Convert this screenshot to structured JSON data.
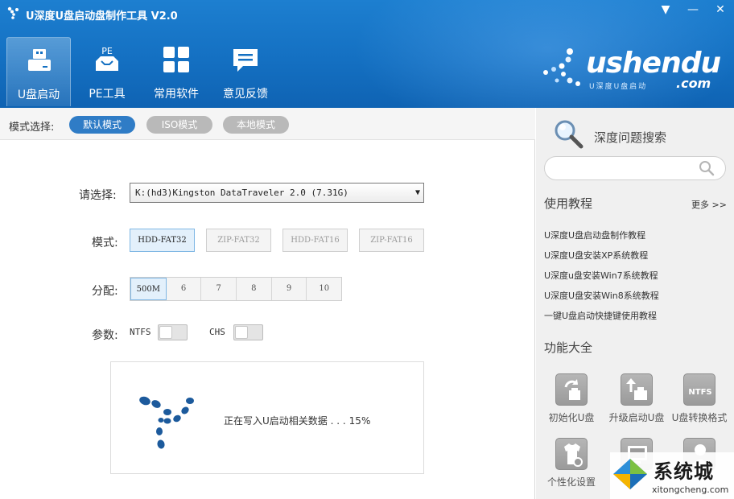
{
  "window": {
    "title": "U深度U盘启动盘制作工具 V2.0",
    "menu_glyph": "▼",
    "min_glyph": "—",
    "close_glyph": "✕"
  },
  "nav": {
    "items": [
      {
        "label": "U盘启动",
        "icon": "usb-drive-icon",
        "active": true
      },
      {
        "label": "PE工具",
        "icon": "pe-tools-icon",
        "active": false
      },
      {
        "label": "常用软件",
        "icon": "apps-grid-icon",
        "active": false
      },
      {
        "label": "意见反馈",
        "icon": "feedback-bubble-icon",
        "active": false
      }
    ],
    "pe_badge": "PE"
  },
  "brand": {
    "name": "ushendu",
    "domain": ".com",
    "subtitle": "U深度U盘启动"
  },
  "mode_bar": {
    "label": "模式选择:",
    "modes": [
      "默认模式",
      "ISO模式",
      "本地模式"
    ],
    "selected": "默认模式"
  },
  "form": {
    "select_label": "请选择:",
    "device_value": "K:(hd3)Kingston DataTraveler 2.0 (7.31G)",
    "format_label": "模式:",
    "formats": [
      "HDD-FAT32",
      "ZIP-FAT32",
      "HDD-FAT16",
      "ZIP-FAT16"
    ],
    "format_selected": "HDD-FAT32",
    "alloc_label": "分配:",
    "allocs": [
      "500M",
      "6",
      "7",
      "8",
      "9",
      "10"
    ],
    "alloc_selected": "500M",
    "param_label": "参数:",
    "ntfs_label": "NTFS",
    "chs_label": "CHS",
    "ntfs_on": false,
    "chs_on": false
  },
  "progress": {
    "text": "正在写入U启动相关数据 . . .",
    "percent_text": "15%",
    "percent": 15
  },
  "side": {
    "search_title": "深度问题搜索",
    "search_placeholder": "",
    "tutorials_title": "使用教程",
    "more_label": "更多 >>",
    "tutorials": [
      "U深度U盘启动盘制作教程",
      "U深度U盘安装XP系统教程",
      "U深度u盘安装Win7系统教程",
      "U深度U盘安装Win8系统教程",
      "一键U盘启动快捷键使用教程"
    ],
    "features_title": "功能大全",
    "features": [
      {
        "label": "初始化U盘",
        "icon": "init-usb-icon"
      },
      {
        "label": "升级启动U盘",
        "icon": "upgrade-usb-icon"
      },
      {
        "label": "U盘转换格式",
        "icon": "ntfs-convert-icon",
        "badge": "NTFS"
      },
      {
        "label": "个性化设置",
        "icon": "personalize-icon"
      },
      {
        "label": "",
        "icon": "simulate-boot-icon"
      },
      {
        "label": "",
        "icon": "shortcut-query-icon"
      }
    ]
  },
  "watermark": {
    "title": "系统城",
    "url": "xitongcheng.com"
  },
  "colors": {
    "header_blue": "#1470c2",
    "accent_blue": "#2f7cc6",
    "inactive_grey": "#b9b9b9",
    "side_bg": "#f0f0f0"
  }
}
